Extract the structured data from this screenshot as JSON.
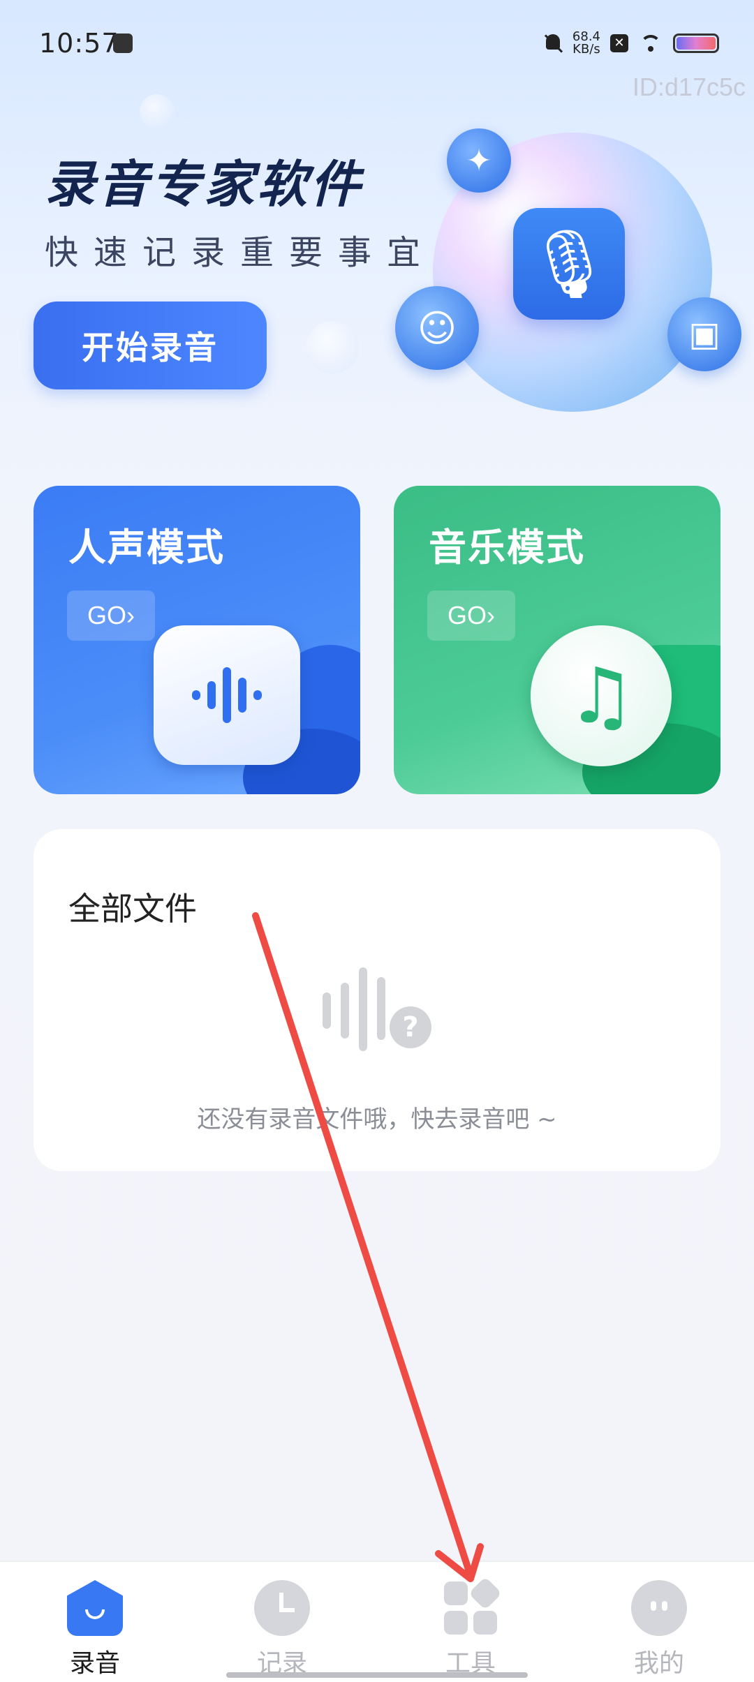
{
  "status_bar": {
    "time": "10:57",
    "net_speed_value": "68.4",
    "net_speed_unit": "KB/s",
    "x_badge": "✕"
  },
  "watermark": "ID:d17c5c",
  "hero": {
    "title": "录音专家软件",
    "subtitle": "快速记录重要事宜",
    "start_button": "开始录音"
  },
  "modes": [
    {
      "title": "人声模式",
      "go_label": "GO›",
      "color": "#3b7cf5"
    },
    {
      "title": "音乐模式",
      "go_label": "GO›",
      "color": "#3bbd86"
    }
  ],
  "files": {
    "title": "全部文件",
    "empty_text": "还没有录音文件哦，快去录音吧 ~"
  },
  "bottom_nav": [
    {
      "label": "录音",
      "icon": "home-icon",
      "active": true
    },
    {
      "label": "记录",
      "icon": "clock-icon",
      "active": false
    },
    {
      "label": "工具",
      "icon": "grid-icon",
      "active": false
    },
    {
      "label": "我的",
      "icon": "face-icon",
      "active": false
    }
  ],
  "colors": {
    "accent": "#3878f2",
    "music_green": "#27b677",
    "annotation_arrow": "#ee4b45"
  }
}
